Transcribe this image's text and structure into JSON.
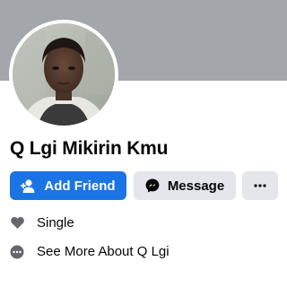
{
  "profile": {
    "name": "Q Lgi Mikirin Kmu",
    "cover_color": "#a3a6ab",
    "avatar_icon": "profile-photo"
  },
  "actions": {
    "add_friend_label": "Add Friend",
    "add_friend_icon": "add-person-icon",
    "message_label": "Message",
    "message_icon": "messenger-icon",
    "more_icon": "more-dots-icon",
    "accent_color": "#1b74e4"
  },
  "details": {
    "relationship": "Single",
    "relationship_icon": "heart-icon",
    "see_more": "See More About Q Lgi",
    "see_more_icon": "more-circle-icon"
  }
}
